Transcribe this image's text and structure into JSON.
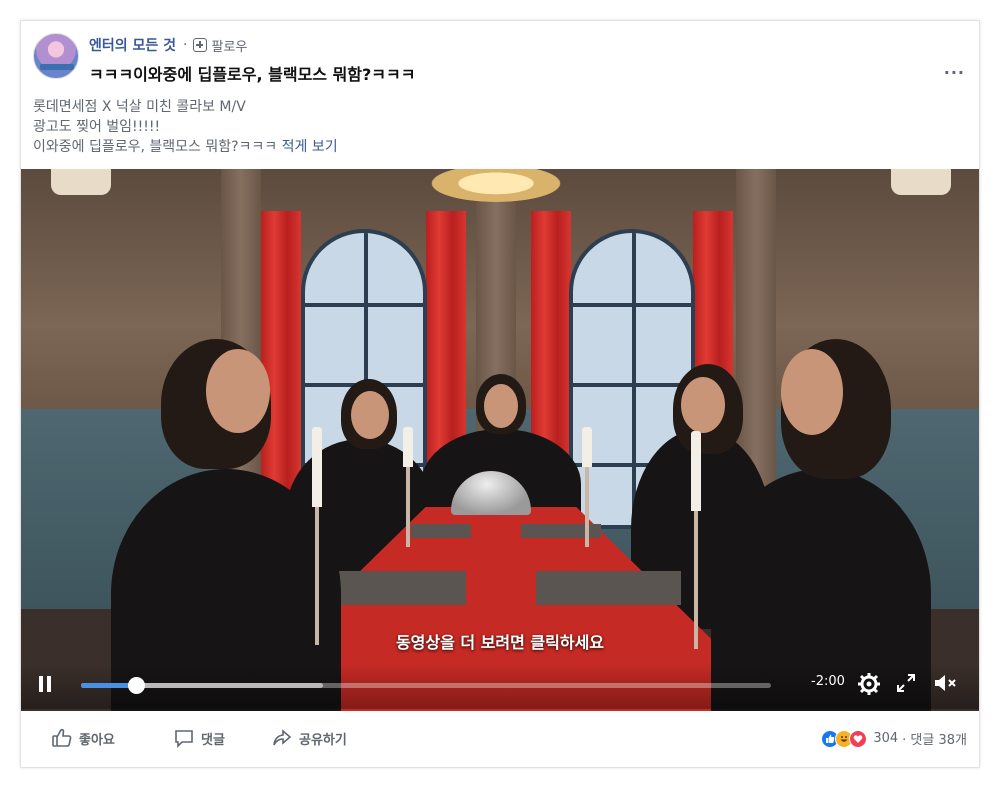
{
  "post": {
    "page_name": "엔터의 모든 것",
    "separator": "·",
    "follow_label": "팔로우",
    "title": "ㅋㅋㅋ이와중에 딥플로우, 블랙모스 뭐함?ㅋㅋㅋ",
    "more_label": "···",
    "body_lines": [
      "롯데면세점 X 넉살 미친 콜라보 M/V",
      "광고도 찢어 벌임!!!!!"
    ],
    "body_last_line": "이와중에 딥플로우, 블랙모스 뭐함?ㅋㅋㅋ",
    "see_more_label": "적게 보기"
  },
  "video": {
    "caption": "동영상을 더 보려면 클릭하세요",
    "time_remaining": "-2:00",
    "progress_fraction": 0.08,
    "buffered_fraction": 0.35,
    "icons": [
      "pause-icon",
      "settings-icon",
      "fullscreen-icon",
      "mute-icon"
    ]
  },
  "footer": {
    "like_label": "좋아요",
    "comment_label": "댓글",
    "share_label": "공유하기",
    "reaction_count": "304",
    "comments_summary": "· 댓글 38개",
    "reaction_icons": [
      "like-reaction",
      "haha-reaction",
      "love-reaction"
    ]
  },
  "colors": {
    "link": "#385898",
    "muted": "#606770",
    "progress": "#4a90e2",
    "like": "#1877f2"
  }
}
